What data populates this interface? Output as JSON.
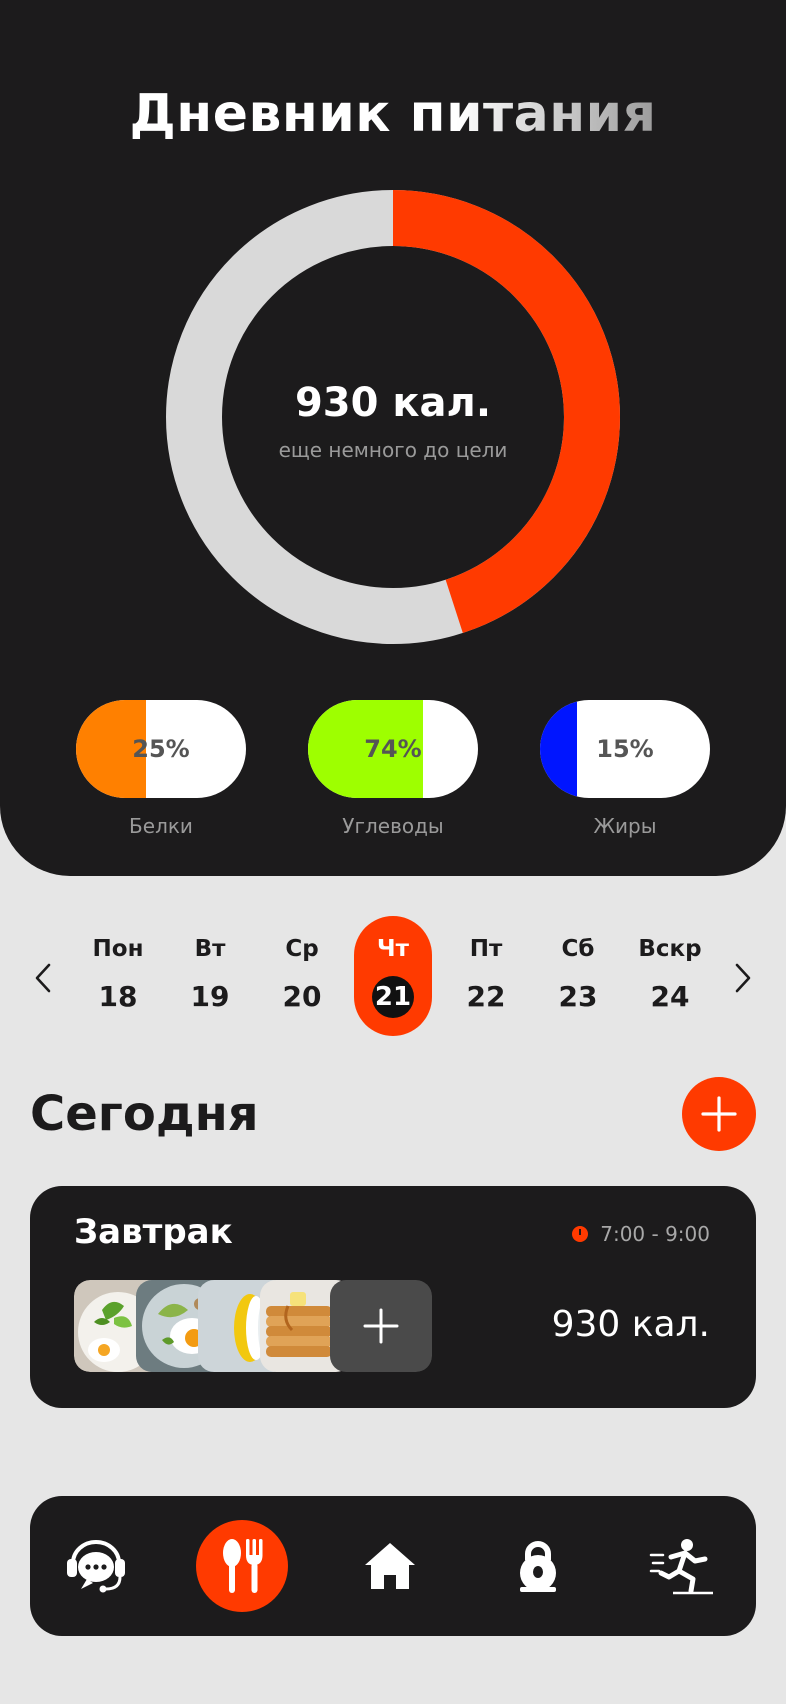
{
  "header": {
    "title": "Дневник питания"
  },
  "summary": {
    "calories": "930 кал.",
    "subtitle": "еще немного до цели",
    "progress": 0.45
  },
  "colors": {
    "accent": "#ff3a00",
    "dark": "#1c1b1c",
    "protein": "#ff8000",
    "carbs": "#9eff00",
    "fats": "#0015ff"
  },
  "macros": [
    {
      "name": "Белки",
      "percent": "25%",
      "fill": 0.41,
      "color": "#ff8000"
    },
    {
      "name": "Углеводы",
      "percent": "74%",
      "fill": 0.675,
      "color": "#9eff00"
    },
    {
      "name": "Жиры",
      "percent": "15%",
      "fill": 0.22,
      "color": "#0015ff"
    }
  ],
  "week": {
    "days": [
      {
        "name": "Пон",
        "date": "18"
      },
      {
        "name": "Вт",
        "date": "19"
      },
      {
        "name": "Ср",
        "date": "20"
      },
      {
        "name": "Чт",
        "date": "21"
      },
      {
        "name": "Пт",
        "date": "22"
      },
      {
        "name": "Сб",
        "date": "23"
      },
      {
        "name": "Вскр",
        "date": "24"
      }
    ],
    "active_index": 3,
    "prev_icon": "chevron-left-icon",
    "next_icon": "chevron-right-icon"
  },
  "section": {
    "title": "Сегодня",
    "add_icon": "plus-icon"
  },
  "meal": {
    "title": "Завтрак",
    "time": "7:00 - 9:00",
    "calories": "930 кал.",
    "photos": [
      "eggs-salad-photo",
      "fried-egg-avocado-photo",
      "lemon-photo",
      "pancakes-photo"
    ]
  },
  "nav": {
    "items": [
      {
        "name": "support",
        "icon": "chat-headset-icon"
      },
      {
        "name": "nutrition",
        "icon": "spoon-fork-icon"
      },
      {
        "name": "home",
        "icon": "house-icon"
      },
      {
        "name": "workouts",
        "icon": "kettlebell-icon"
      },
      {
        "name": "activity",
        "icon": "runner-icon"
      }
    ],
    "active_index": 1
  }
}
